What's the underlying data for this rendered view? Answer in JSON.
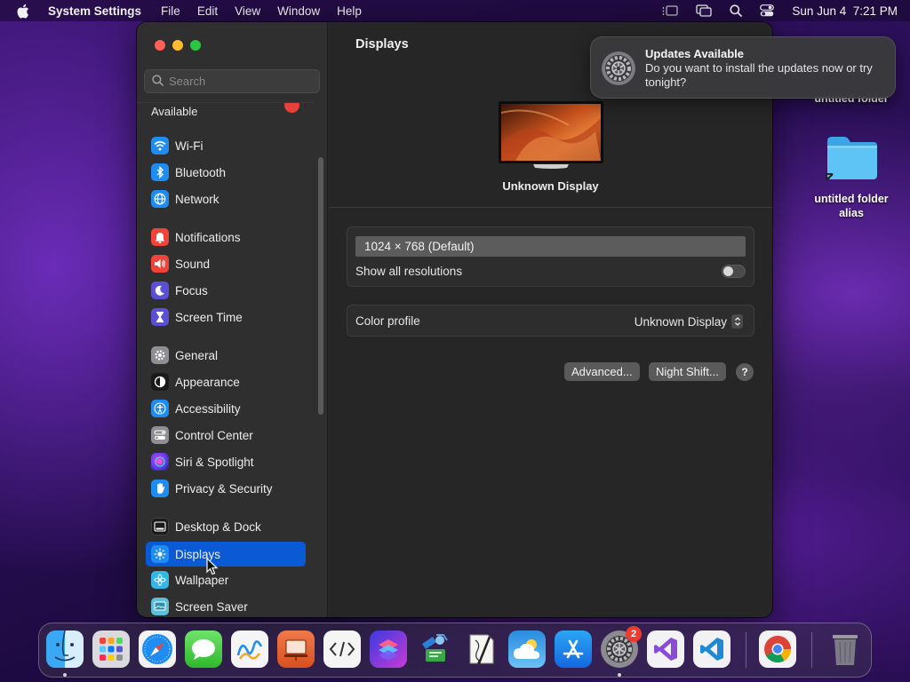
{
  "menubar": {
    "app_name": "System Settings",
    "menus": [
      "File",
      "Edit",
      "View",
      "Window",
      "Help"
    ],
    "datetime": "Sun Jun 4  7:21 PM"
  },
  "sidebar": {
    "search_placeholder": "Search",
    "truncated_item": "Available",
    "items": [
      {
        "label": "Wi-Fi",
        "icon": "wifi-icon"
      },
      {
        "label": "Bluetooth",
        "icon": "bluetooth-icon"
      },
      {
        "label": "Network",
        "icon": "network-icon"
      },
      {
        "label": "Notifications",
        "icon": "bell-icon"
      },
      {
        "label": "Sound",
        "icon": "speaker-icon"
      },
      {
        "label": "Focus",
        "icon": "moon-icon"
      },
      {
        "label": "Screen Time",
        "icon": "hourglass-icon"
      },
      {
        "label": "General",
        "icon": "gear-icon"
      },
      {
        "label": "Appearance",
        "icon": "appearance-icon"
      },
      {
        "label": "Accessibility",
        "icon": "accessibility-icon"
      },
      {
        "label": "Control Center",
        "icon": "control-center-icon"
      },
      {
        "label": "Siri & Spotlight",
        "icon": "siri-icon"
      },
      {
        "label": "Privacy & Security",
        "icon": "hand-icon"
      },
      {
        "label": "Desktop & Dock",
        "icon": "dock-icon"
      },
      {
        "label": "Displays",
        "icon": "sun-icon"
      },
      {
        "label": "Wallpaper",
        "icon": "flower-icon"
      },
      {
        "label": "Screen Saver",
        "icon": "screensaver-icon"
      }
    ],
    "selected": "Displays"
  },
  "content": {
    "title": "Displays",
    "display_name": "Unknown Display",
    "resolution": "1024 × 768 (Default)",
    "show_all_label": "Show all resolutions",
    "show_all_enabled": false,
    "color_profile_label": "Color profile",
    "color_profile_value": "Unknown Display",
    "advanced_button": "Advanced...",
    "night_shift_button": "Night Shift...",
    "help_button": "?"
  },
  "notification": {
    "title": "Updates Available",
    "body": "Do you want to install the updates now or try tonight?"
  },
  "desktop": {
    "folder_top_label": "untitled folder",
    "folder_alias_label": "untitled folder alias"
  },
  "dock": {
    "apps": [
      "Finder",
      "Launchpad",
      "Safari",
      "Messages",
      "Freeform",
      "Keynote",
      "Script Editor",
      "Shortcuts",
      "Automator",
      "Script Debugger",
      "Weather",
      "App Store",
      "System Settings",
      "Visual Studio",
      "Visual Studio Code",
      "Google Chrome",
      "Trash"
    ],
    "settings_badge": "2"
  },
  "colors": {
    "accent": "#0a5ad6",
    "window_bg": "#262626",
    "sidebar_bg": "#2f2f2f"
  }
}
